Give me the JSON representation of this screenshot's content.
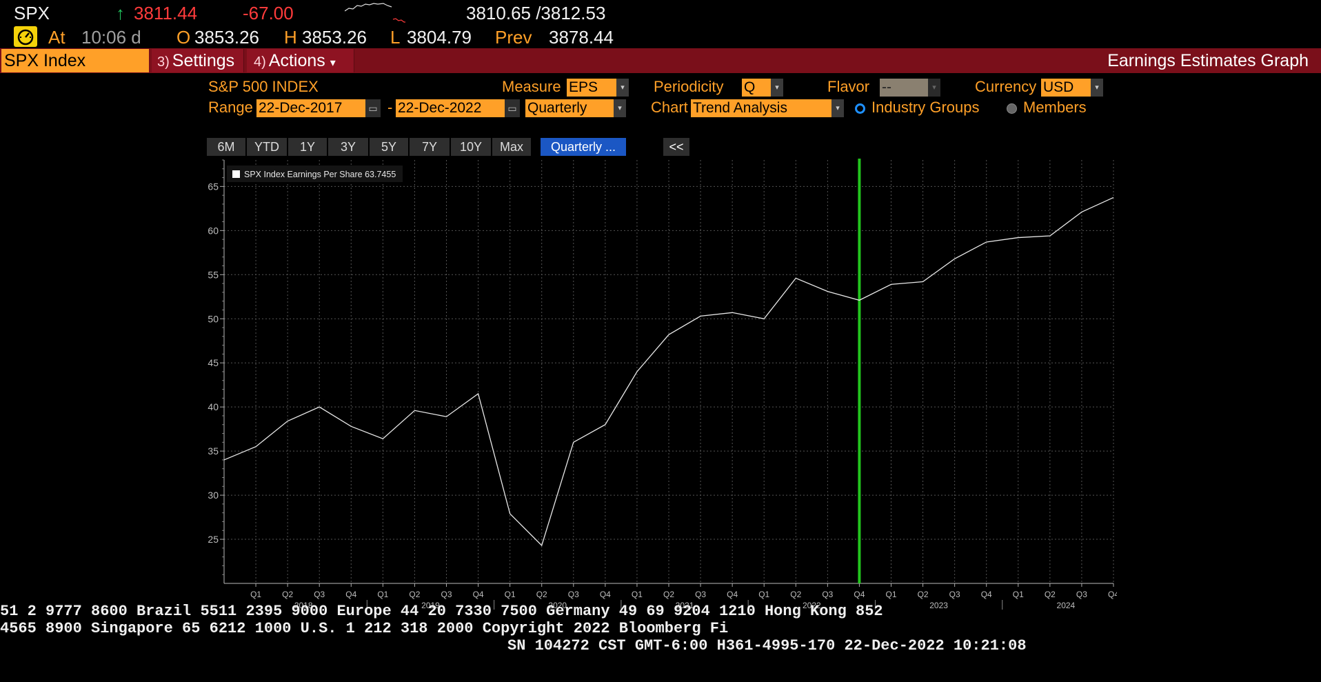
{
  "quote": {
    "ticker": "SPX",
    "change_arrow": "↑",
    "last": "3811.44",
    "net_change": "-67.00",
    "bid_ask": "3810.65 /3812.53",
    "at_label": "At",
    "time": "10:06 d",
    "open_label": "O",
    "open": "3853.26",
    "high_label": "H",
    "high": "3853.26",
    "low_label": "L",
    "low": "3804.79",
    "prev_label": "Prev",
    "prev": "3878.44"
  },
  "sparkline": {
    "white": [
      [
        0,
        14
      ],
      [
        6,
        10
      ],
      [
        12,
        11
      ],
      [
        18,
        6
      ],
      [
        24,
        7
      ],
      [
        30,
        4
      ],
      [
        36,
        5
      ],
      [
        42,
        3
      ],
      [
        48,
        4
      ],
      [
        56,
        3
      ],
      [
        62,
        6
      ],
      [
        68,
        8
      ]
    ],
    "red": [
      [
        70,
        26
      ],
      [
        74,
        25
      ],
      [
        78,
        28
      ],
      [
        82,
        27
      ],
      [
        86,
        30
      ],
      [
        88,
        30
      ]
    ]
  },
  "menu": {
    "ticker_tab": "SPX Index",
    "settings_num": "3)",
    "settings_label": "Settings",
    "actions_num": "4)",
    "actions_label": "Actions",
    "actions_caret": "▾",
    "title": "Earnings Estimates Graph"
  },
  "form": {
    "security_name": "S&P 500 INDEX",
    "measure_label": "Measure",
    "measure_value": "EPS",
    "periodicity_label": "Periodicity",
    "periodicity_value": "Q",
    "flavor_label": "Flavor",
    "flavor_value": "--",
    "currency_label": "Currency",
    "currency_value": "USD",
    "range_label": "Range",
    "range_start": "22-Dec-2017",
    "range_sep": "-",
    "range_end": "22-Dec-2022",
    "frequency_value": "Quarterly",
    "chart_label": "Chart",
    "chart_value": "Trend Analysis",
    "radio_industry": "Industry Groups",
    "radio_members": "Members",
    "dropdown_caret": "▾",
    "calendar_glyph": "▭"
  },
  "period_buttons": [
    "6M",
    "YTD",
    "1Y",
    "3Y",
    "5Y",
    "7Y",
    "10Y",
    "Max"
  ],
  "active_button": "Quarterly ...",
  "collapse_label": "<<",
  "colors": {
    "bloomberg_orange": "#ffa028",
    "menu_red": "#7a0f1a",
    "line": "#e8e8e8",
    "current_marker": "#22c51e",
    "active_blue": "#1b57c4"
  },
  "chart_data": {
    "type": "line",
    "title": "",
    "xlabel": "",
    "ylabel": "",
    "ylim": [
      20,
      68
    ],
    "yticks": [
      25,
      30,
      35,
      40,
      45,
      50,
      55,
      60,
      65
    ],
    "grid": true,
    "legend_position": "top-left",
    "x": [
      "Q4 2017",
      "Q1 2018",
      "Q2 2018",
      "Q3 2018",
      "Q4 2018",
      "Q1 2019",
      "Q2 2019",
      "Q3 2019",
      "Q4 2019",
      "Q1 2020",
      "Q2 2020",
      "Q3 2020",
      "Q4 2020",
      "Q1 2021",
      "Q2 2021",
      "Q3 2021",
      "Q4 2021",
      "Q1 2022",
      "Q2 2022",
      "Q3 2022",
      "Q4 2022",
      "Q1 2023",
      "Q2 2023",
      "Q3 2023",
      "Q4 2023",
      "Q1 2024",
      "Q2 2024",
      "Q3 2024",
      "Q4 2024"
    ],
    "quarter_labels": [
      "Q1",
      "Q2",
      "Q3",
      "Q4",
      "Q1",
      "Q2",
      "Q3",
      "Q4",
      "Q1",
      "Q2",
      "Q3",
      "Q4",
      "Q1",
      "Q2",
      "Q3",
      "Q4",
      "Q1",
      "Q2",
      "Q3",
      "Q4",
      "Q1",
      "Q2",
      "Q3",
      "Q4",
      "Q1",
      "Q2",
      "Q3",
      "Q4"
    ],
    "year_labels": [
      {
        "year": "2018",
        "after_index": 2
      },
      {
        "year": "2019",
        "after_index": 6
      },
      {
        "year": "2020",
        "after_index": 10
      },
      {
        "year": "2021",
        "after_index": 14
      },
      {
        "year": "2022",
        "after_index": 18
      },
      {
        "year": "2023",
        "after_index": 22
      },
      {
        "year": "2024",
        "after_index": 26
      }
    ],
    "series": [
      {
        "name": "SPX Index Earnings Per Share 63.7455",
        "values": [
          34.0,
          35.5,
          38.4,
          40.0,
          37.8,
          36.4,
          39.6,
          38.9,
          41.5,
          27.9,
          24.3,
          36.0,
          38.0,
          44.0,
          48.2,
          50.3,
          50.7,
          50.0,
          54.6,
          53.1,
          52.1,
          53.9,
          54.2,
          56.8,
          58.7,
          59.2,
          59.4,
          62.1,
          63.7455
        ]
      }
    ],
    "current_period_index": 20
  },
  "ticker_tape": {
    "line1": "51 2 9777 8600 Brazil 5511 2395 9000 Europe 44 20 7330 7500 Germany 49 69 9204 1210 Hong Kong 852",
    "line2": " 4565 8900       Singapore 65 6212 1000       U.S. 1 212 318 2000       Copyright 2022 Bloomberg Fi",
    "line3": "SN 104272 CST  GMT-6:00 H361-4995-170 22-Dec-2022 10:21:08"
  }
}
